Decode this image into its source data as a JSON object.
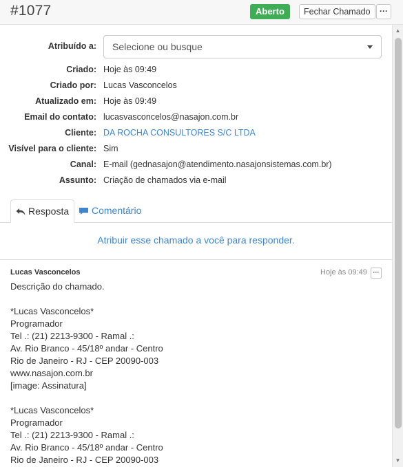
{
  "header": {
    "ticket_number": "#1077",
    "status": "Aberto",
    "close_label": "Fechar Chamado",
    "more_label": "···"
  },
  "details": {
    "assigned_label": "Atribuído a:",
    "assigned_placeholder": "Selecione ou busque",
    "fields": [
      {
        "label": "Criado:",
        "value": "Hoje às 09:49"
      },
      {
        "label": "Criado por:",
        "value": "Lucas Vasconcelos"
      },
      {
        "label": "Atualizado em:",
        "value": "Hoje às 09:49"
      },
      {
        "label": "Email do contato:",
        "value": "lucasvasconcelos@nasajon.com.br"
      },
      {
        "label": "Cliente:",
        "value": "DA ROCHA CONSULTORES S/C LTDA"
      },
      {
        "label": "Visível para o cliente:",
        "value": "Sim"
      },
      {
        "label": "Canal:",
        "value": "E-mail (gednasajon@atendimento.nasajonsistemas.com.br)"
      },
      {
        "label": "Assunto:",
        "value": "Criação de chamados via e-mail"
      }
    ]
  },
  "tabs": {
    "reply": "Resposta",
    "comment": "Comentário"
  },
  "assign_prompt": "Atribuir esse chamado a você para responder.",
  "message": {
    "author": "Lucas Vasconcelos",
    "time": "Hoje às 09:49",
    "more_label": "···",
    "lines": [
      "Descrição do chamado.",
      "",
      "*Lucas Vasconcelos*",
      "Programador",
      "Tel .: (21) 2213-9300 - Ramal .:",
      "Av. Rio Branco - 45/18º andar - Centro",
      "Rio de Janeiro - RJ - CEP 20090-003",
      "www.nasajon.com.br",
      "[image: Assinatura]",
      "",
      "*Lucas Vasconcelos*",
      "Programador",
      "Tel .: (21) 2213-9300 - Ramal .:",
      "Av. Rio Branco - 45/18º andar - Centro",
      "Rio de Janeiro - RJ - CEP 20090-003"
    ]
  },
  "colors": {
    "status_green": "#3fad55",
    "link_blue": "#3e85cc"
  }
}
